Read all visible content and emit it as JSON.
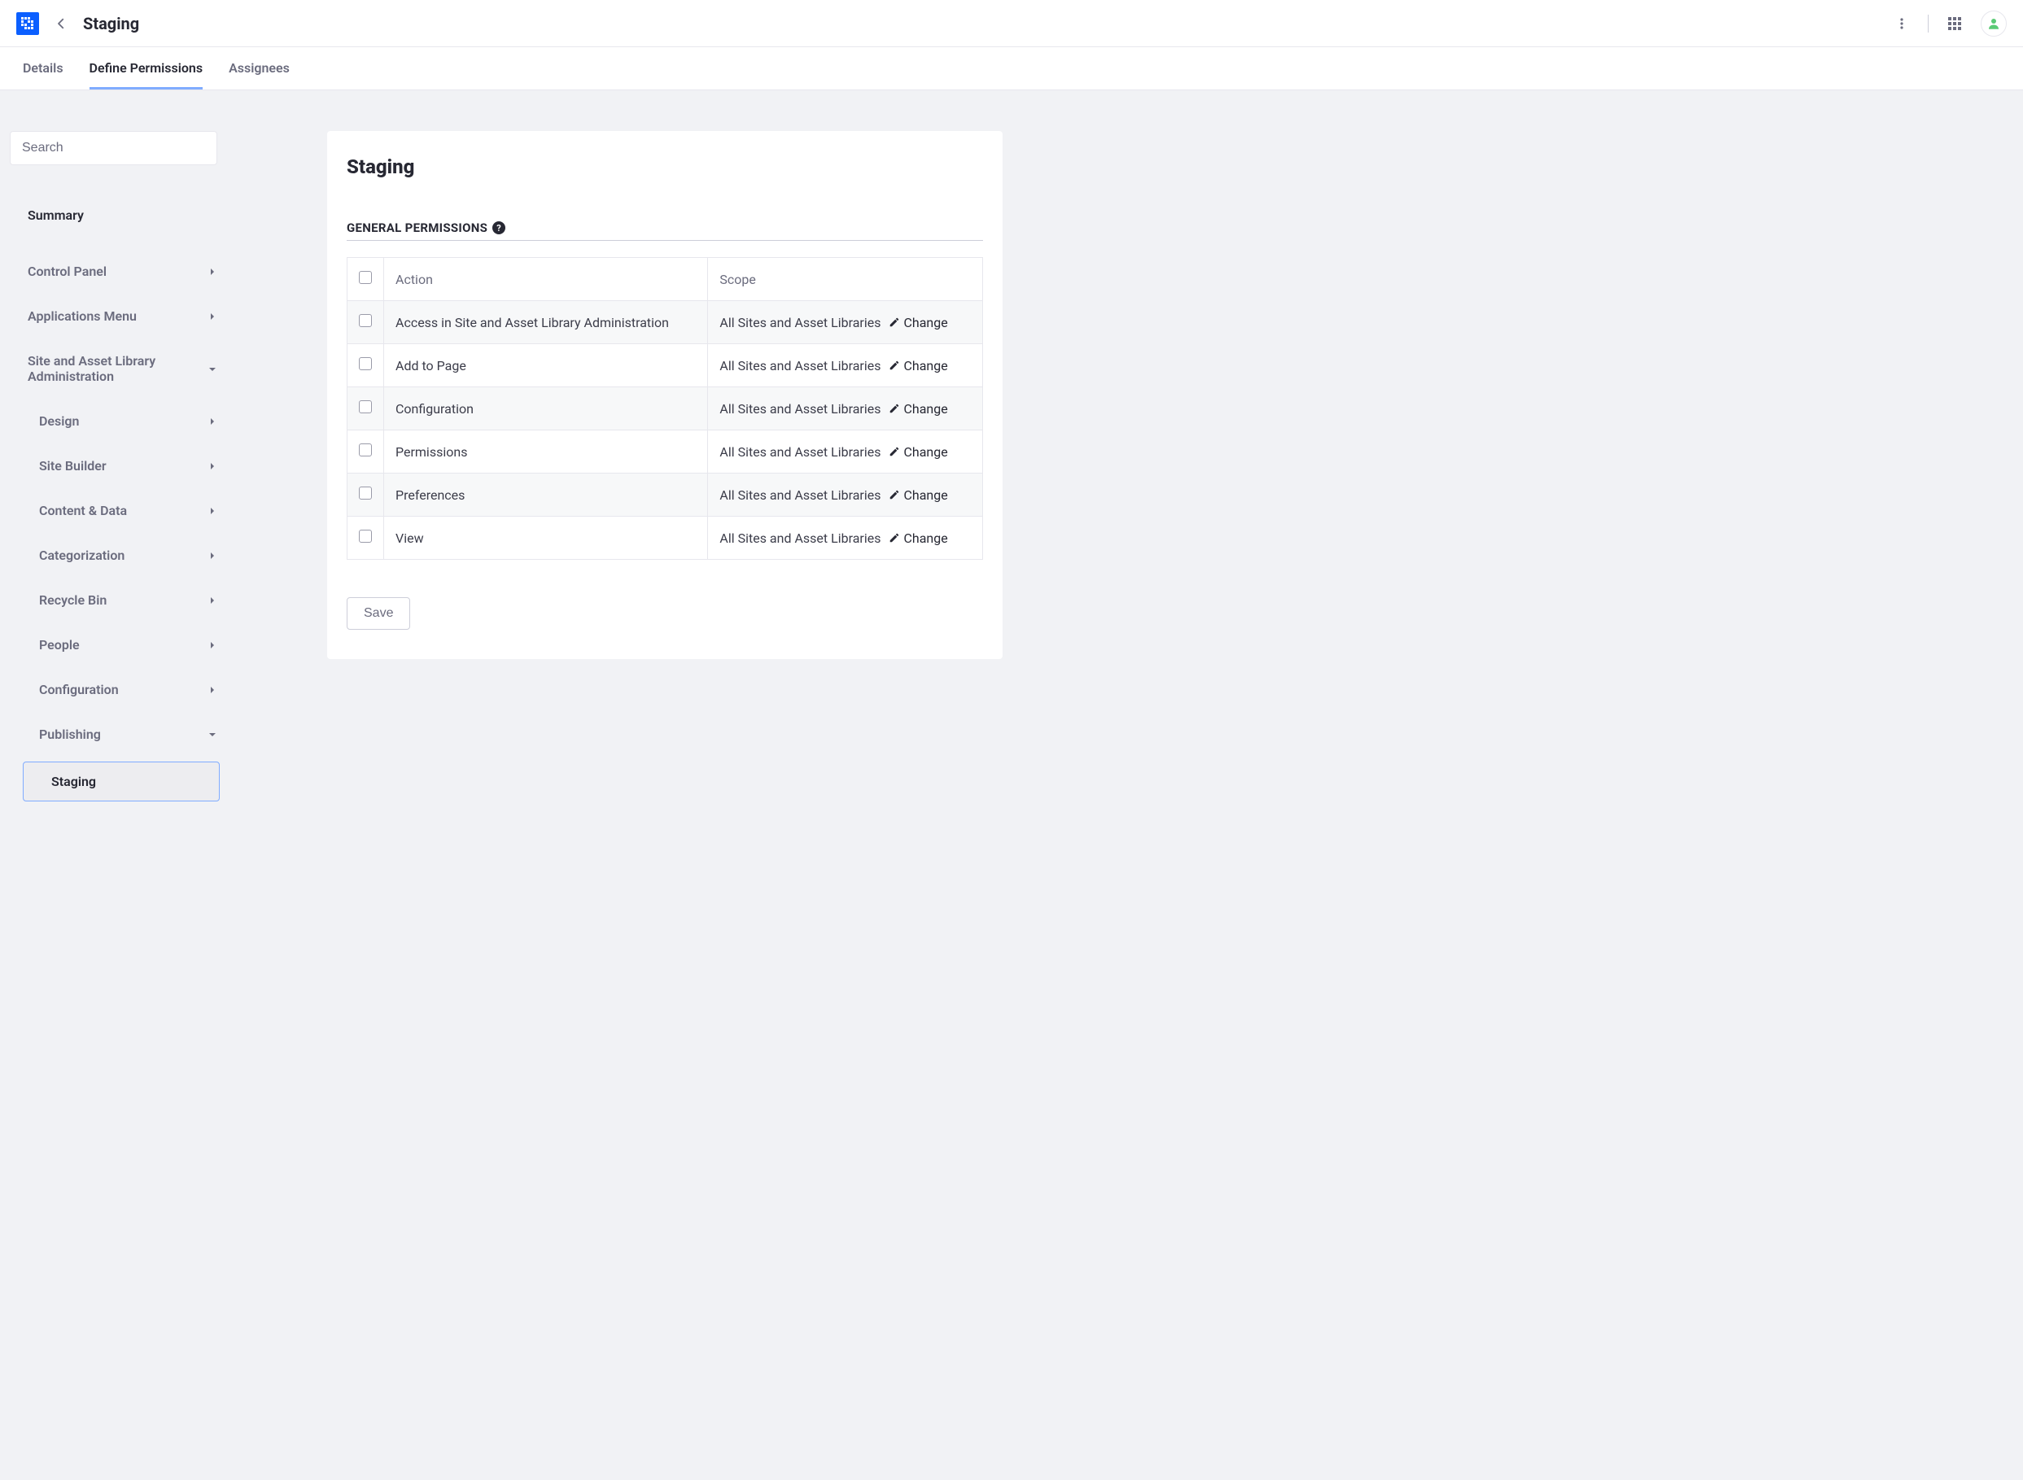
{
  "header": {
    "title": "Staging"
  },
  "tabs": [
    {
      "label": "Details",
      "active": false
    },
    {
      "label": "Define Permissions",
      "active": true
    },
    {
      "label": "Assignees",
      "active": false
    }
  ],
  "sidebar": {
    "search_placeholder": "Search",
    "summary_label": "Summary",
    "items": [
      {
        "label": "Control Panel",
        "type": "parent"
      },
      {
        "label": "Applications Menu",
        "type": "parent"
      },
      {
        "label": "Site and Asset Library Administration",
        "type": "parent-open"
      },
      {
        "label": "Design",
        "type": "child"
      },
      {
        "label": "Site Builder",
        "type": "child"
      },
      {
        "label": "Content & Data",
        "type": "child"
      },
      {
        "label": "Categorization",
        "type": "child"
      },
      {
        "label": "Recycle Bin",
        "type": "child"
      },
      {
        "label": "People",
        "type": "child"
      },
      {
        "label": "Configuration",
        "type": "child"
      },
      {
        "label": "Publishing",
        "type": "child-open"
      },
      {
        "label": "Staging",
        "type": "selected"
      }
    ]
  },
  "panel": {
    "title": "Staging",
    "section_title": "GENERAL PERMISSIONS",
    "columns": {
      "action": "Action",
      "scope": "Scope"
    },
    "rows": [
      {
        "action": "Access in Site and Asset Library Administration",
        "scope": "All Sites and Asset Libraries",
        "change": "Change"
      },
      {
        "action": "Add to Page",
        "scope": "All Sites and Asset Libraries",
        "change": "Change"
      },
      {
        "action": "Configuration",
        "scope": "All Sites and Asset Libraries",
        "change": "Change"
      },
      {
        "action": "Permissions",
        "scope": "All Sites and Asset Libraries",
        "change": "Change"
      },
      {
        "action": "Preferences",
        "scope": "All Sites and Asset Libraries",
        "change": "Change"
      },
      {
        "action": "View",
        "scope": "All Sites and Asset Libraries",
        "change": "Change"
      }
    ],
    "save_label": "Save"
  }
}
